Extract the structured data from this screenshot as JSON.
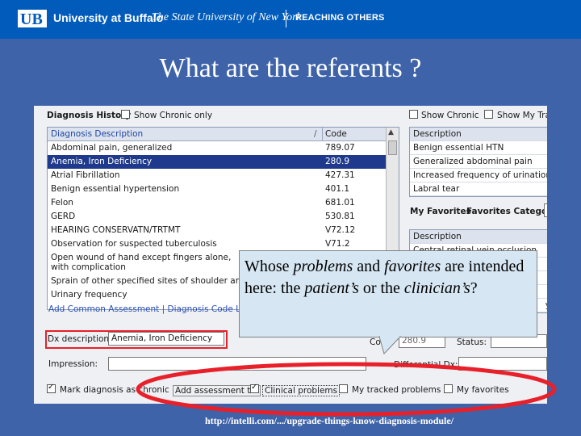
{
  "header": {
    "university": "University at Buffalo",
    "state": "The State University of New York",
    "tagline": "REACHING OTHERS",
    "colors": {
      "banner": "#005bbb",
      "background": "#3f63a8"
    }
  },
  "slide": {
    "title": "What are the referents ?"
  },
  "screenshot": {
    "diagnosis_history_label": "Diagnosis History",
    "show_chronic_only": "Show Chronic only",
    "columns": {
      "description": "Diagnosis Description",
      "code": "Code"
    },
    "rows": [
      {
        "description": "Abdominal pain, generalized",
        "code": "789.07"
      },
      {
        "description": "Anemia, Iron Deficiency",
        "code": "280.9",
        "selected": true
      },
      {
        "description": "Atrial Fibrillation",
        "code": "427.31"
      },
      {
        "description": "Benign essential hypertension",
        "code": "401.1"
      },
      {
        "description": "Felon",
        "code": "681.01"
      },
      {
        "description": "GERD",
        "code": "530.81"
      },
      {
        "description": "HEARING CONSERVATN/TRTMT",
        "code": "V72.12"
      },
      {
        "description": "Observation for suspected tuberculosis",
        "code": "V71.2"
      },
      {
        "description": "Open wound of hand except fingers alone, with complication",
        "code": ""
      },
      {
        "description": "Sprain of other specified sites of shoulder and u",
        "code": ""
      },
      {
        "description": "Urinary frequency",
        "code": ""
      }
    ],
    "right_top": {
      "show_chronic": "Show Chronic",
      "show_my_tra": "Show My Tra",
      "header": "Description",
      "items": [
        "Benign essential HTN",
        "Generalized abdominal pain",
        "Increased frequency of urination",
        "Labral tear"
      ]
    },
    "my_favorites": {
      "label": "My Favorites",
      "category_label": "Favorites Category:"
    },
    "right_bottom": {
      "header": "Description",
      "items": [
        "Central retinal vein occlusion",
        "",
        "",
        "",
        "y"
      ]
    },
    "links": {
      "add_common": "Add Common Assessment",
      "sep": "|",
      "dx_lookup": "Diagnosis Code Look"
    },
    "dx_description_label": "Dx description:",
    "dx_description_value": "Anemia, Iron Deficiency",
    "code_label": "Code:",
    "code_value": "280.9",
    "status_label": "Status:",
    "impression_label": "Impression:",
    "differential_label": "Differential Dx:",
    "mark_chronic": "Mark diagnosis as chronic",
    "add_assessment_to": "Add assessment to:",
    "clinical_problems": "Clinical problems",
    "my_tracked_problems": "My tracked problems",
    "my_favorites_opt": "My favorites"
  },
  "callout": {
    "t1": "Whose ",
    "t2": "problems",
    "t3": " and ",
    "t4": "favorites",
    "t5": " are intended here: the ",
    "t6": "patient’s",
    "t7": " or the ",
    "t8": "clinician’s",
    "t9": "?"
  },
  "footer": {
    "source": "http://intelli.com/.../upgrade-things-know-diagnosis-module/"
  },
  "highlight": {
    "color": "#e8202a"
  }
}
